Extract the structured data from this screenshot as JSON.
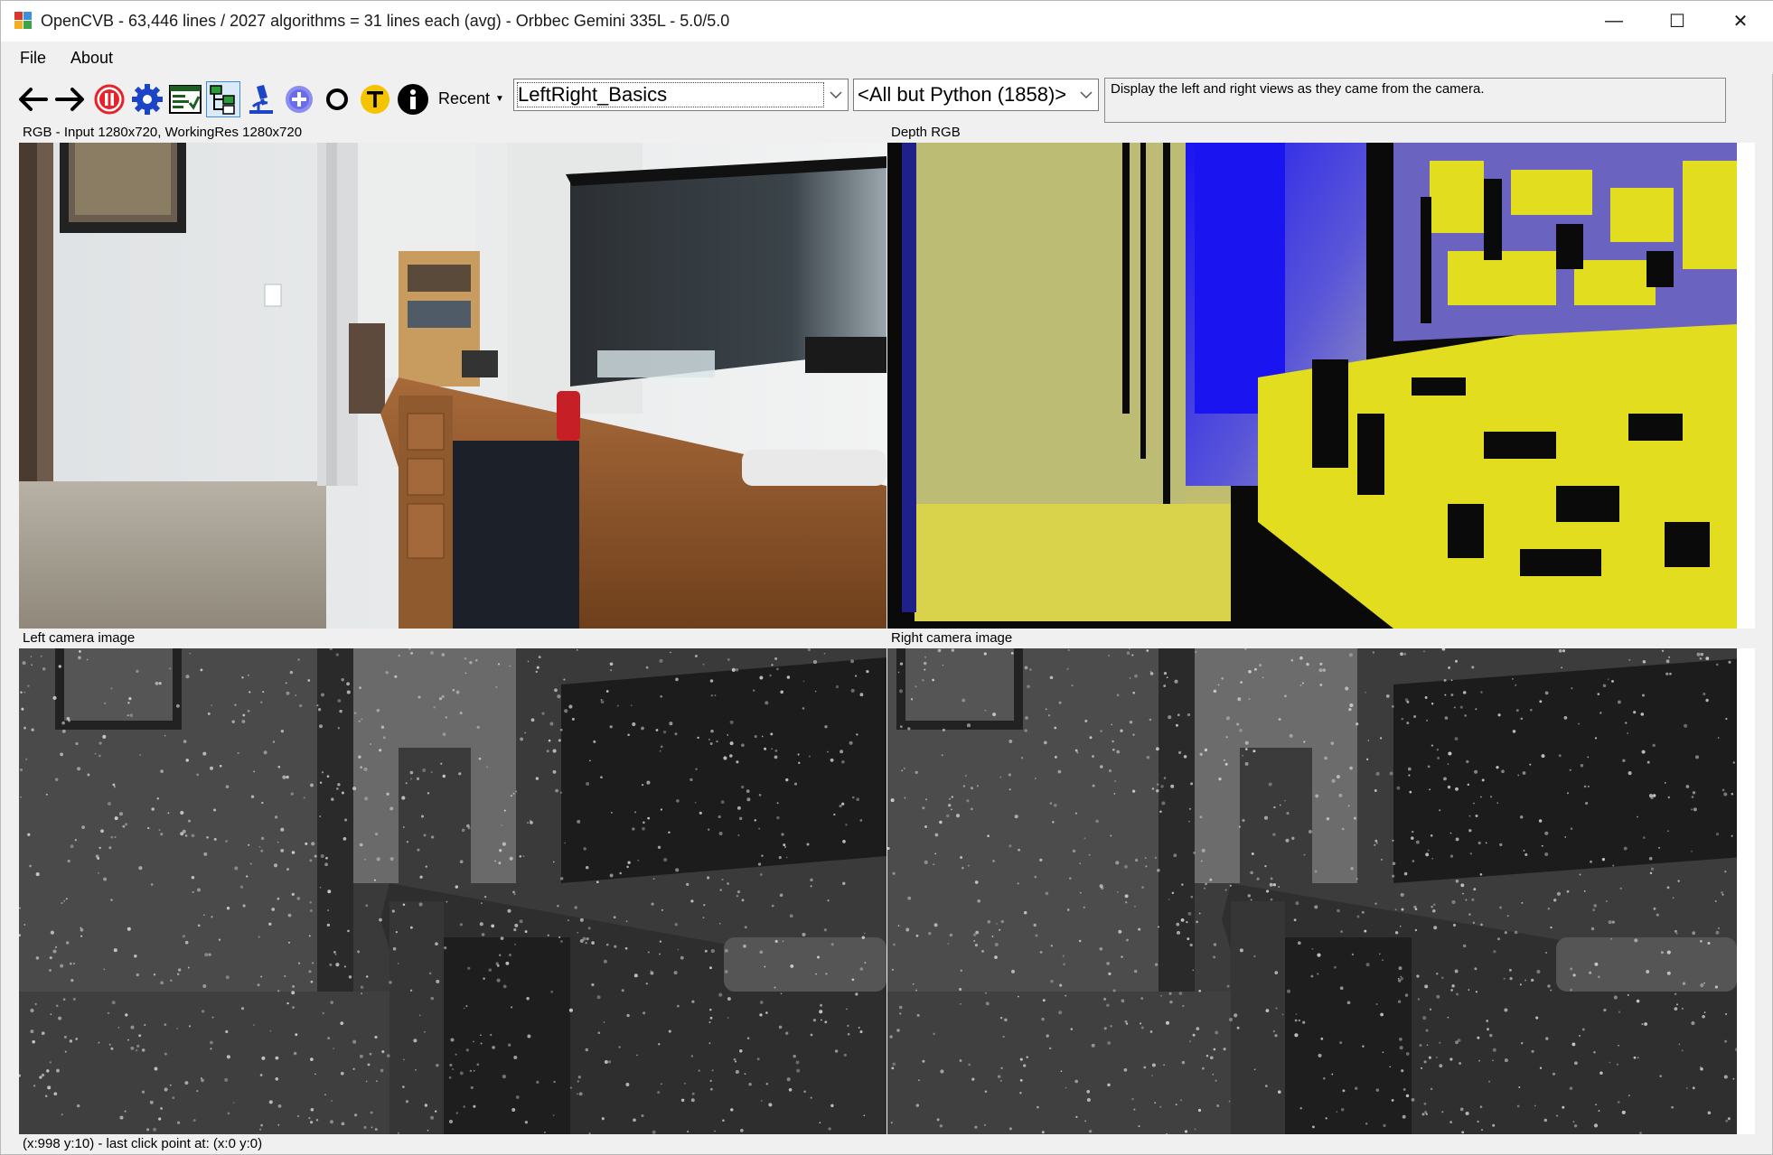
{
  "window": {
    "title": "OpenCVB - 63,446 lines / 2027 algorithms = 31 lines each (avg) - Orbbec Gemini 335L - 5.0/5.0",
    "controls": {
      "minimize": "—",
      "maximize": "☐",
      "close": "✕"
    }
  },
  "menu": {
    "file": "File",
    "about": "About"
  },
  "toolbar": {
    "buttons": [
      {
        "name": "back-arrow-icon"
      },
      {
        "name": "forward-arrow-icon"
      },
      {
        "name": "pause-icon"
      },
      {
        "name": "settings-gear-icon"
      },
      {
        "name": "options-panel-icon"
      },
      {
        "name": "tree-view-icon"
      },
      {
        "name": "microscope-icon"
      },
      {
        "name": "add-circle-icon"
      },
      {
        "name": "letter-o-icon"
      },
      {
        "name": "letter-t-icon"
      },
      {
        "name": "info-icon"
      }
    ],
    "recent_label": "Recent",
    "algorithm_value": "LeftRight_Basics",
    "group_value": "<All but Python (1858)>",
    "description": "Display the left and right views as they came from the camera."
  },
  "panels": {
    "rgb_label": "RGB - Input 1280x720, WorkingRes 1280x720",
    "depth_label": "Depth RGB",
    "left_label": "Left camera image",
    "right_label": "Right camera image"
  },
  "status": {
    "text": "(x:998 y:10) - last click point at: (x:0 y:0)"
  },
  "colors": {
    "depth_yellow": "#e2dd1e",
    "depth_blue": "#1a14f0",
    "pause_red": "#e8212a",
    "gear_blue": "#1b44c6",
    "accent": "#3d8fe0"
  }
}
